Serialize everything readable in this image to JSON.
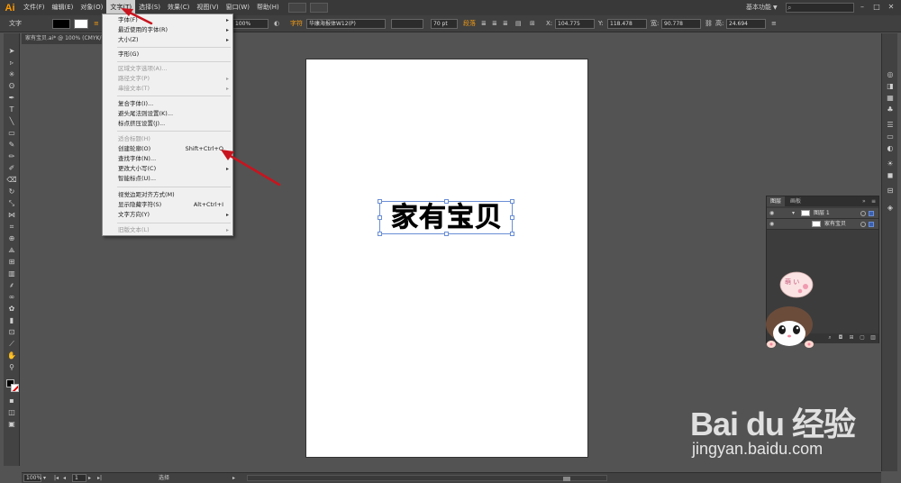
{
  "app": {
    "logo": "Ai",
    "menus": [
      "文件(F)",
      "编辑(E)",
      "对象(O)",
      "文字(T)",
      "选择(S)",
      "效果(C)",
      "视图(V)",
      "窗口(W)",
      "帮助(H)"
    ],
    "active_menu": "文字(T)",
    "workspace": "基本功能"
  },
  "control_bar": {
    "mode_label": "文字",
    "opacity_value": "100%",
    "char_label": "字符",
    "font_family": "华康海报体W12(P)",
    "font_size": "70 pt",
    "paragraph_label": "段落",
    "x_label": "X:",
    "x_value": "104.775",
    "y_label": "Y:",
    "y_value": "118.478",
    "w_label": "宽:",
    "w_value": "90.778",
    "h_label": "高:",
    "h_value": "24.694"
  },
  "document": {
    "tab_title": "家有宝贝.ai* @ 100% (CMYK/预览)",
    "selected_text": "家有宝贝"
  },
  "type_menu": {
    "items": [
      {
        "label": "字体(F)",
        "submenu": true,
        "enabled": true
      },
      {
        "label": "最近使用的字体(R)",
        "submenu": true,
        "enabled": true
      },
      {
        "label": "大小(Z)",
        "submenu": true,
        "enabled": true
      },
      {
        "label": "字形(G)",
        "enabled": true
      },
      {
        "label": "区域文字选项(A)...",
        "enabled": false
      },
      {
        "label": "路径文字(P)",
        "submenu": true,
        "enabled": false
      },
      {
        "label": "串接文本(T)",
        "submenu": true,
        "enabled": false
      },
      {
        "label": "复合字体(I)...",
        "enabled": true
      },
      {
        "label": "避头尾法则设置(K)...",
        "enabled": true
      },
      {
        "label": "标点挤压设置(J)...",
        "enabled": true
      },
      {
        "label": "适合标题(H)",
        "enabled": false
      },
      {
        "label": "创建轮廓(O)",
        "shortcut": "Shift+Ctrl+O",
        "enabled": true
      },
      {
        "label": "查找字体(N)...",
        "enabled": true
      },
      {
        "label": "更改大小写(C)",
        "submenu": true,
        "enabled": true
      },
      {
        "label": "智能标点(U)...",
        "enabled": true
      },
      {
        "label": "视觉边距对齐方式(M)",
        "enabled": true
      },
      {
        "label": "显示隐藏字符(S)",
        "shortcut": "Alt+Ctrl+I",
        "enabled": true
      },
      {
        "label": "文字方向(Y)",
        "submenu": true,
        "enabled": true
      },
      {
        "label": "旧版文本(L)",
        "submenu": true,
        "enabled": false
      }
    ]
  },
  "layers_panel": {
    "tabs": [
      "图层",
      "画板"
    ],
    "layers": [
      {
        "name": "图层 1"
      },
      {
        "name": "家有宝贝"
      }
    ]
  },
  "sticker": {
    "bubble_text": "萌 い"
  },
  "status_bar": {
    "zoom": "100%",
    "artboard_number": "1",
    "tool_name": "选择"
  },
  "watermark": {
    "logo": "Bai du 经验",
    "url": "jingyan.baidu.com"
  },
  "colors": {
    "accent_orange": "#f39c12",
    "annotation_red": "#c8141e",
    "selection_blue": "#6a8ed6"
  }
}
